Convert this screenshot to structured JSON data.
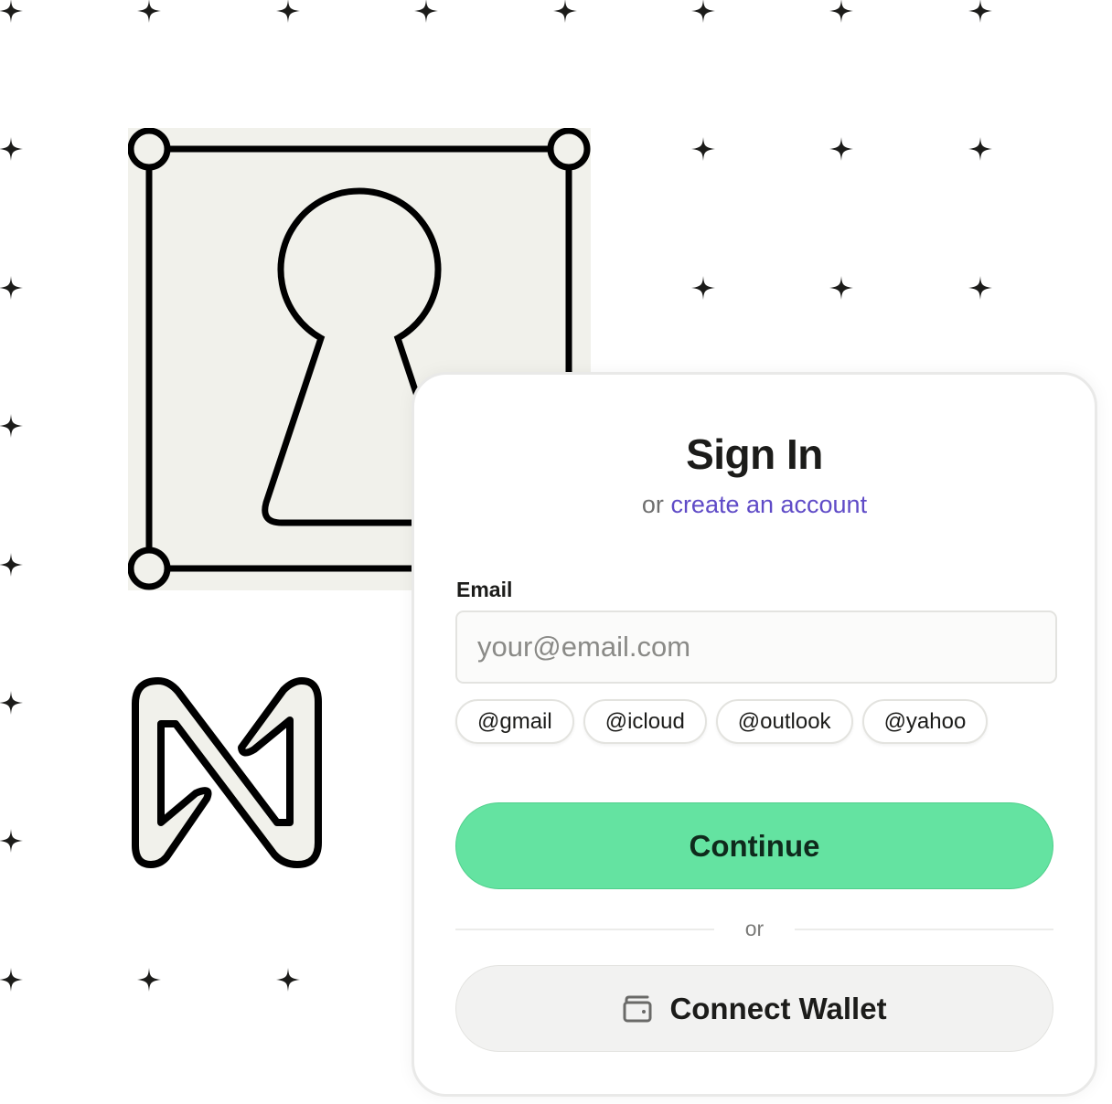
{
  "signin": {
    "title": "Sign In",
    "subtitle_prefix": "or",
    "create_account_link": "create an account",
    "email_label": "Email",
    "email_value": "",
    "email_placeholder": "your@email.com",
    "domain_chips": [
      "@gmail",
      "@icloud",
      "@outlook",
      "@yahoo"
    ],
    "continue_label": "Continue",
    "divider_text": "or",
    "wallet_label": "Connect Wallet",
    "wallet_icon": "wallet-icon"
  },
  "decorations": {
    "background_pattern": "sparkle-star-grid",
    "illustrations": [
      "keyhole-icon",
      "near-logo-icon"
    ]
  },
  "colors": {
    "accent_green": "#64e3a1",
    "link_purple": "#5f4bc7",
    "illustration_fill": "#f1f1eb",
    "text_dark": "#1c1c1a"
  }
}
